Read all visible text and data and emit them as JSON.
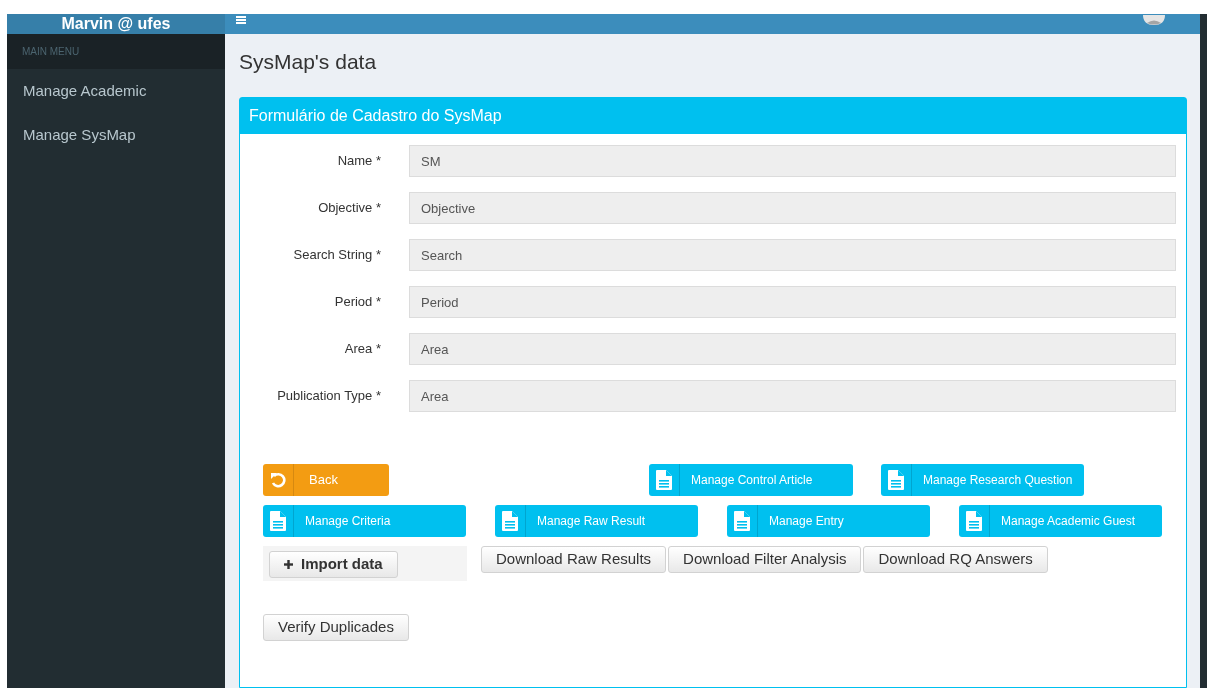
{
  "header": {
    "brand": "Marvin @ ufes"
  },
  "sidebar": {
    "heading": "MAIN MENU",
    "items": [
      {
        "label": "Manage Academic"
      },
      {
        "label": "Manage SysMap"
      }
    ]
  },
  "page_title": "SysMap's data",
  "form": {
    "title": "Formulário de Cadastro do SysMap",
    "fields": [
      {
        "label": "Name *",
        "value": "SM"
      },
      {
        "label": "Objective *",
        "value": "Objective"
      },
      {
        "label": "Search String *",
        "value": "Search"
      },
      {
        "label": "Period *",
        "value": "Period"
      },
      {
        "label": "Area *",
        "value": "Area"
      },
      {
        "label": "Publication Type *",
        "value": "Area"
      }
    ],
    "back_button": "Back",
    "top_buttons": [
      "Manage Control Article",
      "Manage Research Question"
    ],
    "manage_buttons": [
      "Manage Criteria",
      "Manage Raw Result",
      "Manage Entry",
      "Manage Academic Guest"
    ],
    "import_button": "Import data",
    "download_buttons": [
      "Download Raw Results",
      "Download Filter Analysis",
      "Download RQ Answers"
    ],
    "verify_button": "Verify Duplicades"
  }
}
